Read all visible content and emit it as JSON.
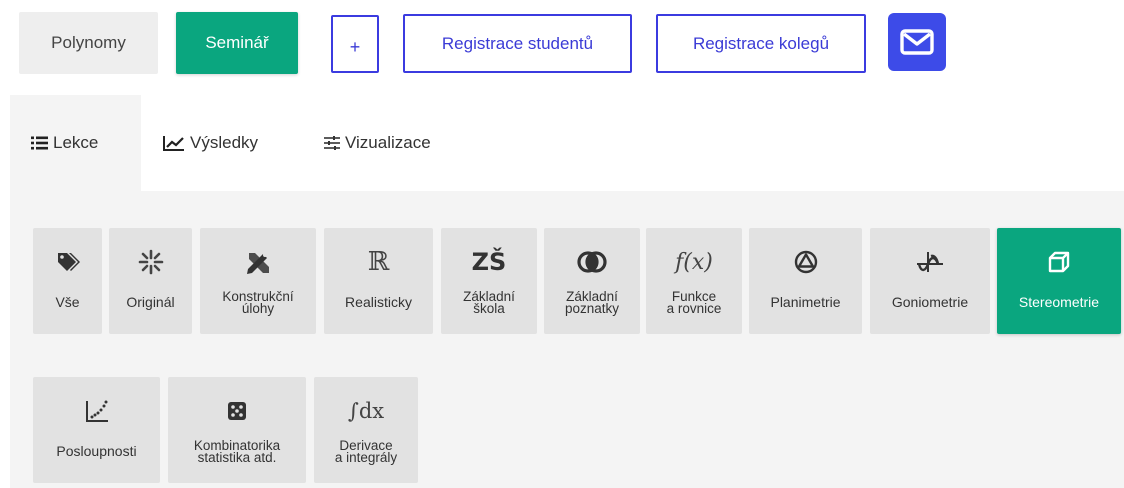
{
  "toolbar": {
    "polynomy": "Polynomy",
    "seminar": "Seminář",
    "plus": "+",
    "register_students": "Registrace studentů",
    "register_colleagues": "Registrace kolegů",
    "mail_icon": "mail-icon"
  },
  "tabs": [
    {
      "label": "Lekce",
      "icon": "list-icon",
      "active": true
    },
    {
      "label": "Výsledky",
      "icon": "chart-line-icon",
      "active": false
    },
    {
      "label": "Vizualizace",
      "icon": "sliders-icon",
      "active": false
    }
  ],
  "categories_row1": [
    {
      "label": "Vše",
      "icon": "tags-icon"
    },
    {
      "label": "Originál",
      "icon": "burst-icon"
    },
    {
      "label": "Konstrukční\núlohy",
      "icon": "compass-ruler-icon"
    },
    {
      "label": "Realisticky",
      "icon": "real-numbers-icon",
      "glyph": "ℝ"
    },
    {
      "label": "Základní\nškola",
      "icon": "zs-icon",
      "glyph": "ZŠ"
    },
    {
      "label": "Základní\npoznatky",
      "icon": "venn-icon"
    },
    {
      "label": "Funkce\na rovnice",
      "icon": "function-icon",
      "glyph": "f(x)"
    },
    {
      "label": "Planimetrie",
      "icon": "triangle-circle-icon"
    },
    {
      "label": "Goniometrie",
      "icon": "sine-wave-icon"
    },
    {
      "label": "Stereometrie",
      "icon": "cube-icon",
      "active": true
    }
  ],
  "categories_row2": [
    {
      "label": "Posloupnosti",
      "icon": "scatter-plot-icon"
    },
    {
      "label": "Kombinatorika\nstatistika atd.",
      "icon": "dice-icon"
    },
    {
      "label": "Derivace\na integrály",
      "icon": "integral-icon",
      "glyph": "∫dx"
    }
  ],
  "colors": {
    "accent_green": "#0aa67f",
    "accent_blue": "#3d4be8",
    "tile_gray": "#e2e2e2",
    "panel_gray": "#f4f4f4"
  }
}
